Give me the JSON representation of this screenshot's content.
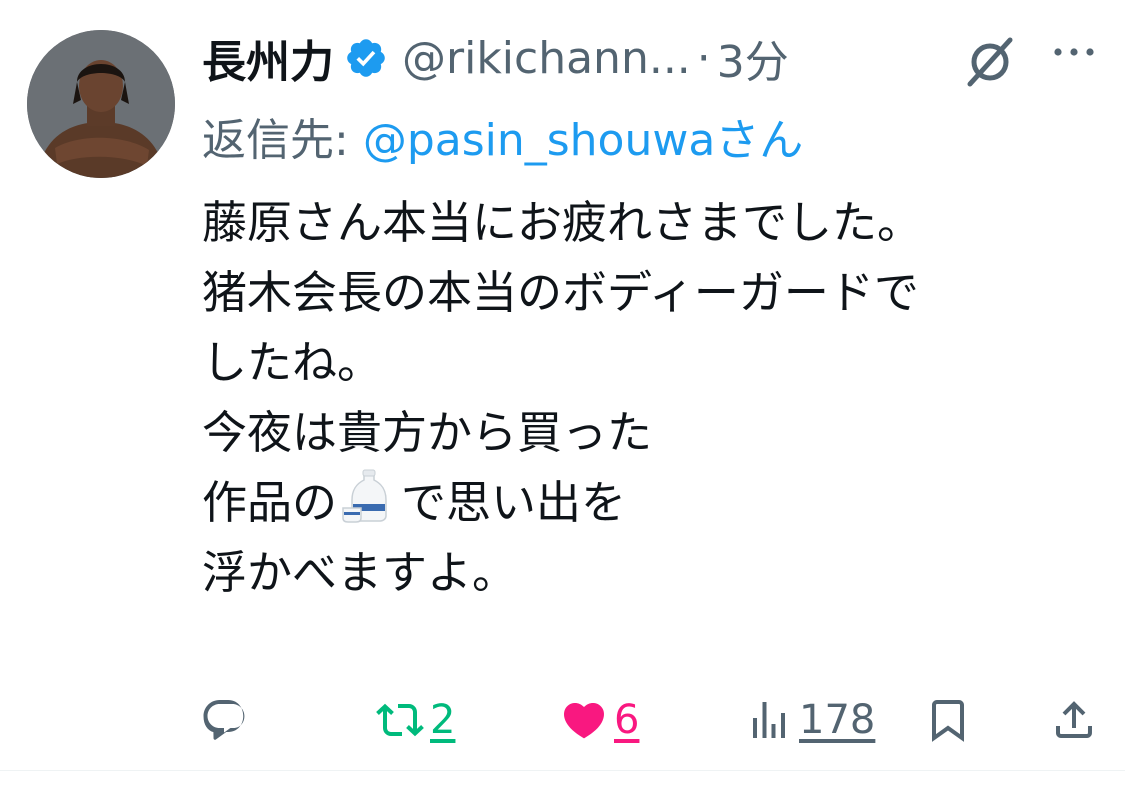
{
  "tweet": {
    "author": {
      "name": "長州力",
      "handle": "@rikichann...",
      "verified": true
    },
    "separator": "·",
    "time": "3分",
    "reply_prefix": "返信先: ",
    "reply_mention": "@pasin_shouwa",
    "reply_suffix": "さん",
    "body": {
      "line1": "藤原さん本当にお疲れさまでした。",
      "line2": "猪木会長の本当のボディーガードで",
      "line3": "したね。",
      "line4": "今夜は貴方から買った",
      "line5a": "作品の",
      "line5b": "で思い出を",
      "line6": "浮かべますよ。"
    },
    "stats": {
      "reposts": "2",
      "likes": "6",
      "views": "178"
    },
    "icons": {
      "reply": "reply-icon",
      "repost": "repost-icon",
      "like": "heart-icon",
      "views": "views-icon",
      "bookmark": "bookmark-icon",
      "share": "share-icon",
      "grok": "grok-icon",
      "more": "more-icon",
      "verified": "verified-badge-icon",
      "emoji": "sake-emoji"
    },
    "colors": {
      "accent": "#1d9bf0",
      "repost": "#00ba7c",
      "like": "#f91880",
      "secondary": "#536471",
      "text": "#0f1419"
    }
  }
}
